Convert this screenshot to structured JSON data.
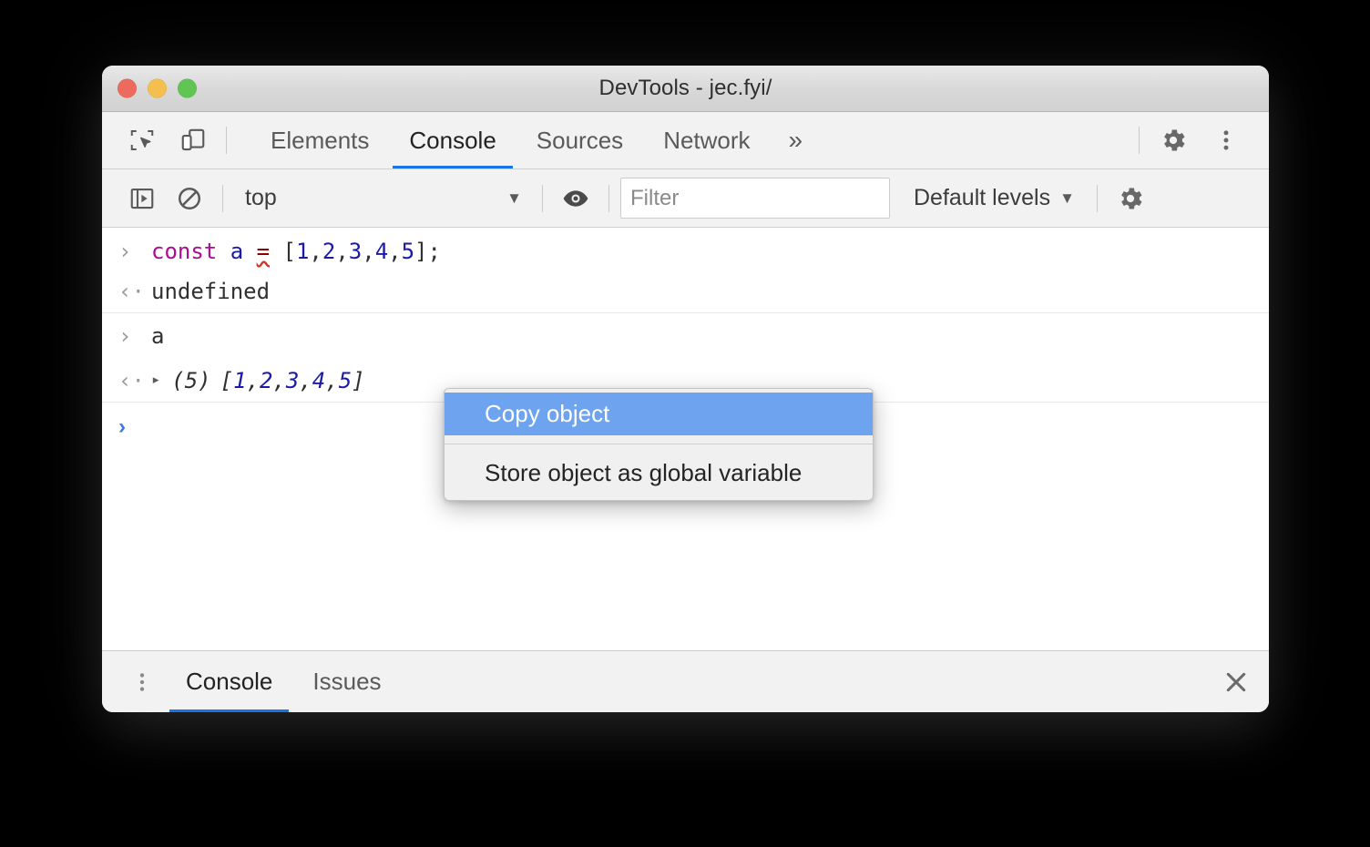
{
  "window": {
    "title": "DevTools - jec.fyi/",
    "traffic_lights": [
      {
        "name": "close",
        "color": "#ED6A5E"
      },
      {
        "name": "minimize",
        "color": "#F5BF4F"
      },
      {
        "name": "zoom",
        "color": "#61C554"
      }
    ]
  },
  "colors": {
    "accent": "#1a73e8",
    "menu_selected": "#6da3ef",
    "keyword": "#aa0d91",
    "value_blue": "#1a1aa6",
    "prompt_blue": "#3b78e7"
  },
  "toolbar": {
    "inspect_icon": "inspect-element-icon",
    "device_icon": "device-toolbar-icon",
    "tabs": [
      {
        "label": "Elements",
        "active": false
      },
      {
        "label": "Console",
        "active": true
      },
      {
        "label": "Sources",
        "active": false
      },
      {
        "label": "Network",
        "active": false
      }
    ],
    "more_tabs": "»",
    "settings_icon": "gear-icon",
    "main_menu_icon": "kebab-menu-icon"
  },
  "console_toolbar": {
    "sidebar_toggle_icon": "console-sidebar-icon",
    "clear_icon": "clear-console-icon",
    "context": {
      "value": "top",
      "caret": "▼"
    },
    "eye_icon": "live-expression-eye-icon",
    "filter": {
      "value": "",
      "placeholder": "Filter"
    },
    "levels": {
      "label": "Default levels",
      "caret": "▼"
    },
    "settings_icon": "console-settings-gear-icon"
  },
  "console": {
    "messages": [
      {
        "kind": "input",
        "gutter": "›",
        "tokens": [
          {
            "text": "const",
            "type": "keyword"
          },
          {
            "text": " ",
            "type": "plain"
          },
          {
            "text": "a",
            "type": "variable"
          },
          {
            "text": " ",
            "type": "plain"
          },
          {
            "text": "=",
            "type": "operator-misspelled"
          },
          {
            "text": " ",
            "type": "plain"
          },
          {
            "text": "[",
            "type": "punct"
          },
          {
            "text": "1",
            "type": "number"
          },
          {
            "text": ",",
            "type": "punct"
          },
          {
            "text": "2",
            "type": "number"
          },
          {
            "text": ",",
            "type": "punct"
          },
          {
            "text": "3",
            "type": "number"
          },
          {
            "text": ",",
            "type": "punct"
          },
          {
            "text": "4",
            "type": "number"
          },
          {
            "text": ",",
            "type": "punct"
          },
          {
            "text": "5",
            "type": "number"
          },
          {
            "text": "]",
            "type": "punct"
          },
          {
            "text": ";",
            "type": "punct"
          }
        ]
      },
      {
        "kind": "output",
        "gutter": "‹·",
        "text": "undefined"
      },
      {
        "kind": "input",
        "gutter": "›",
        "text": "a"
      }
    ],
    "array_result": {
      "gutter": "‹·",
      "disclosure": "▸",
      "count_label": "(5)",
      "open_bracket": "[",
      "values": [
        "1",
        "2",
        "3",
        "4",
        "5"
      ],
      "separator": ", ",
      "close_bracket": "]"
    },
    "prompt": {
      "gutter": "›",
      "value": ""
    }
  },
  "context_menu": {
    "items": [
      {
        "label": "Copy object",
        "selected": true
      },
      {
        "label": "Store object as global variable",
        "selected": false
      }
    ]
  },
  "drawer": {
    "menu_icon": "drawer-kebab-menu-icon",
    "tabs": [
      {
        "label": "Console",
        "active": true
      },
      {
        "label": "Issues",
        "active": false
      }
    ],
    "close_icon": "close-icon",
    "close_glyph": "✕"
  }
}
